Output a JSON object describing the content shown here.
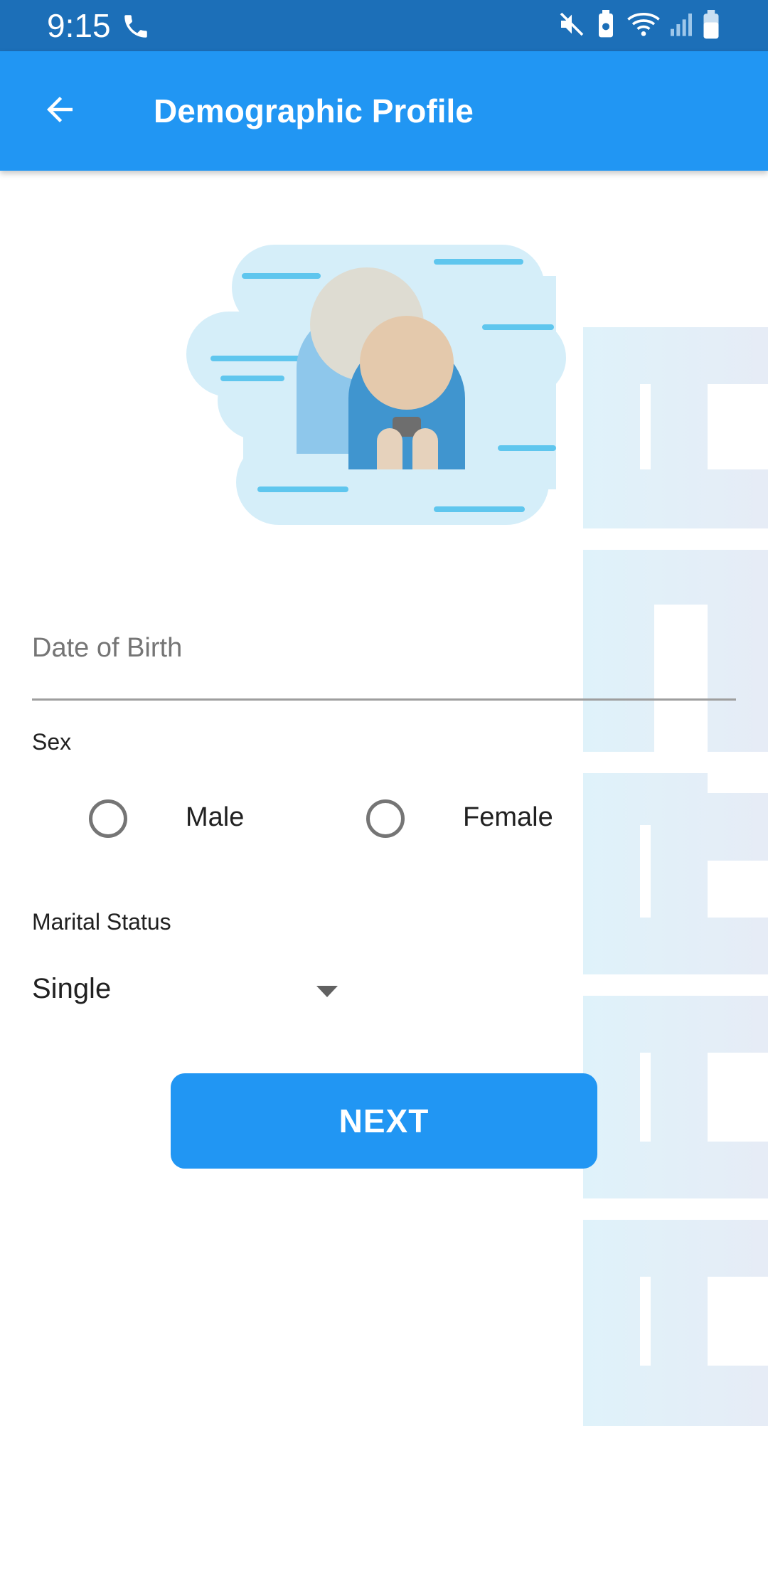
{
  "status_bar": {
    "time": "9:15",
    "icons": [
      "phone-icon",
      "mute-icon",
      "battery-saver-icon",
      "wifi-icon",
      "signal-icon",
      "battery-icon"
    ]
  },
  "app_bar": {
    "title": "Demographic Profile",
    "back_icon": "arrow-back-icon"
  },
  "form": {
    "dob": {
      "placeholder": "Date of Birth",
      "value": ""
    },
    "sex": {
      "label": "Sex",
      "options": [
        {
          "label": "Male",
          "selected": false
        },
        {
          "label": "Female",
          "selected": false
        }
      ]
    },
    "marital_status": {
      "label": "Marital Status",
      "value": "Single"
    },
    "next_label": "NEXT"
  },
  "colors": {
    "status_bar": "#1c6fb8",
    "app_bar": "#2196f3",
    "button": "#2196f3",
    "text": "#212121",
    "hint": "#757575"
  }
}
